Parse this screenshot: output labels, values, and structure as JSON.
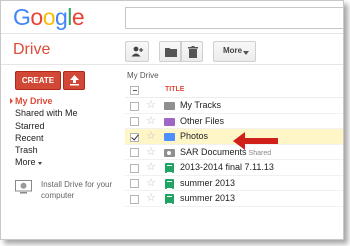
{
  "header": {
    "logo_letters": [
      {
        "ch": "G",
        "color": "#4285f4"
      },
      {
        "ch": "o",
        "color": "#ea4335"
      },
      {
        "ch": "o",
        "color": "#fbbc05"
      },
      {
        "ch": "g",
        "color": "#4285f4"
      },
      {
        "ch": "l",
        "color": "#34a853"
      },
      {
        "ch": "e",
        "color": "#ea4335"
      }
    ],
    "search_value": ""
  },
  "drive_title": "Drive",
  "toolbar": {
    "share_icon": "add-person-icon",
    "folder_icon": "folder-icon",
    "delete_icon": "trash-icon",
    "more_label": "More"
  },
  "sidebar": {
    "create_label": "CREATE",
    "upload_icon": "upload-icon",
    "items": [
      {
        "label": "My Drive",
        "active": true
      },
      {
        "label": "Shared with Me",
        "active": false
      },
      {
        "label": "Starred",
        "active": false
      },
      {
        "label": "Recent",
        "active": false
      },
      {
        "label": "Trash",
        "active": false
      },
      {
        "label": "More",
        "active": false,
        "has_caret": true
      }
    ],
    "install_text": "Install Drive for your computer",
    "install_icon": "computer-icon"
  },
  "main": {
    "breadcrumb": "My Drive",
    "column_title": "TITLE",
    "files": [
      {
        "name": "My Tracks",
        "type": "folder-grey",
        "selected": false,
        "shared": ""
      },
      {
        "name": "Other Files",
        "type": "folder-purple",
        "selected": false,
        "shared": ""
      },
      {
        "name": "Photos",
        "type": "folder-blue",
        "selected": true,
        "shared": ""
      },
      {
        "name": "SAR Documents",
        "type": "folder-shared",
        "selected": false,
        "shared": "Shared"
      },
      {
        "name": "2013-2014 final 7.11.13",
        "type": "sheet",
        "selected": false,
        "shared": ""
      },
      {
        "name": "summer 2013",
        "type": "sheet",
        "selected": false,
        "shared": ""
      },
      {
        "name": "summer 2013",
        "type": "sheet",
        "selected": false,
        "shared": ""
      }
    ]
  },
  "annotation": {
    "arrow_color": "#d0201a"
  }
}
